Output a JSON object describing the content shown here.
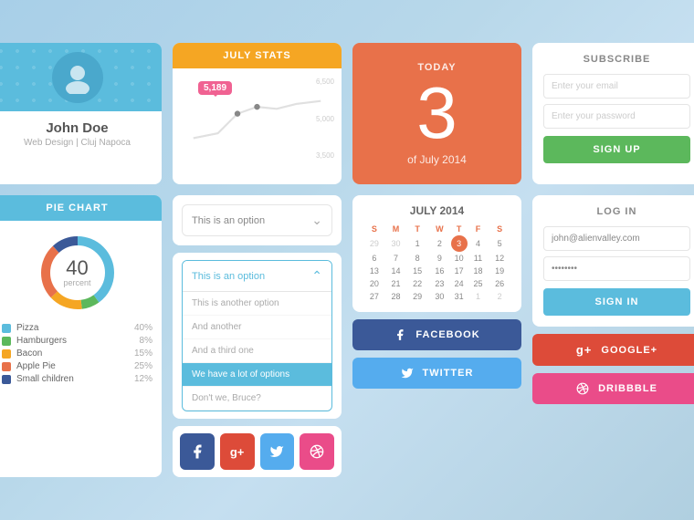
{
  "profile": {
    "name": "John Doe",
    "subtitle": "Web Design | Cluj Napoca"
  },
  "stats": {
    "header": "JULY STATS",
    "value": "5,189",
    "y_labels": [
      "6,500",
      "5,000",
      "3,500"
    ]
  },
  "today": {
    "label": "TODAY",
    "number": "3",
    "sub": "of July 2014"
  },
  "subscribe": {
    "title": "SUBSCRIBE",
    "email_placeholder": "Enter your email",
    "password_placeholder": "Enter your password",
    "button": "SIGN UP"
  },
  "pie_chart": {
    "header": "PIE CHART",
    "value": "40",
    "unit": "percent",
    "legend": [
      {
        "label": "Pizza",
        "pct": "40%",
        "color": "#5bbcdd"
      },
      {
        "label": "Hamburgers",
        "pct": "8%",
        "color": "#5cb85c"
      },
      {
        "label": "Bacon",
        "pct": "15%",
        "color": "#f5a623"
      },
      {
        "label": "Apple Pie",
        "pct": "25%",
        "color": "#e8714a"
      },
      {
        "label": "Small children",
        "pct": "12%",
        "color": "#3b5998"
      }
    ]
  },
  "dropdown": {
    "closed_option": "This is an option",
    "open_option": "This is an option",
    "options": [
      "This is another option",
      "And another",
      "And a third one",
      "We have a lot of options",
      "Don't we, Bruce?"
    ]
  },
  "social_icons": [
    {
      "name": "facebook",
      "icon": "f",
      "color": "#3b5998"
    },
    {
      "name": "google-plus",
      "icon": "g+",
      "color": "#dd4b39"
    },
    {
      "name": "twitter",
      "icon": "t",
      "color": "#55acee"
    },
    {
      "name": "dribbble",
      "icon": "d",
      "color": "#ea4c89"
    }
  ],
  "calendar": {
    "title": "JULY 2014",
    "days_header": [
      "S",
      "M",
      "T",
      "W",
      "T",
      "F",
      "S"
    ],
    "today": "3"
  },
  "facebook_btn": "FACEBOOK",
  "twitter_btn": "TWITTER",
  "google_btn": "GOOGLE+",
  "dribbble_btn": "DRIBBBLE",
  "login": {
    "title": "LOG IN",
    "email": "john@alienvalley.com",
    "password": "••••••••",
    "button": "SIGN IN"
  }
}
